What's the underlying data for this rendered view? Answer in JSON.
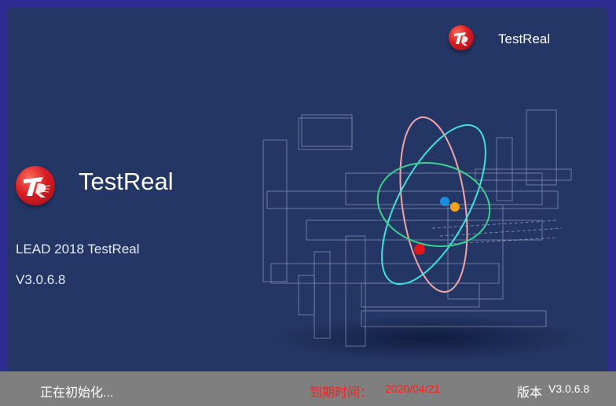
{
  "header": {
    "title": "TestReal",
    "logo_icon": "testreal-logo-icon"
  },
  "main": {
    "title": "TestReal",
    "product": "LEAD 2018 TestReal",
    "version": "V3.0.6.8"
  },
  "footer": {
    "status": "正在初始化...",
    "expiry_label": "到期时间：",
    "expiry_date": "2020/04/21",
    "version_label": "版本",
    "version_value": "V3.0.6.8"
  },
  "colors": {
    "border": "#2e2b93",
    "background": "#243665",
    "footer": "#7f7f7f",
    "expiry": "#ff1e1e"
  }
}
